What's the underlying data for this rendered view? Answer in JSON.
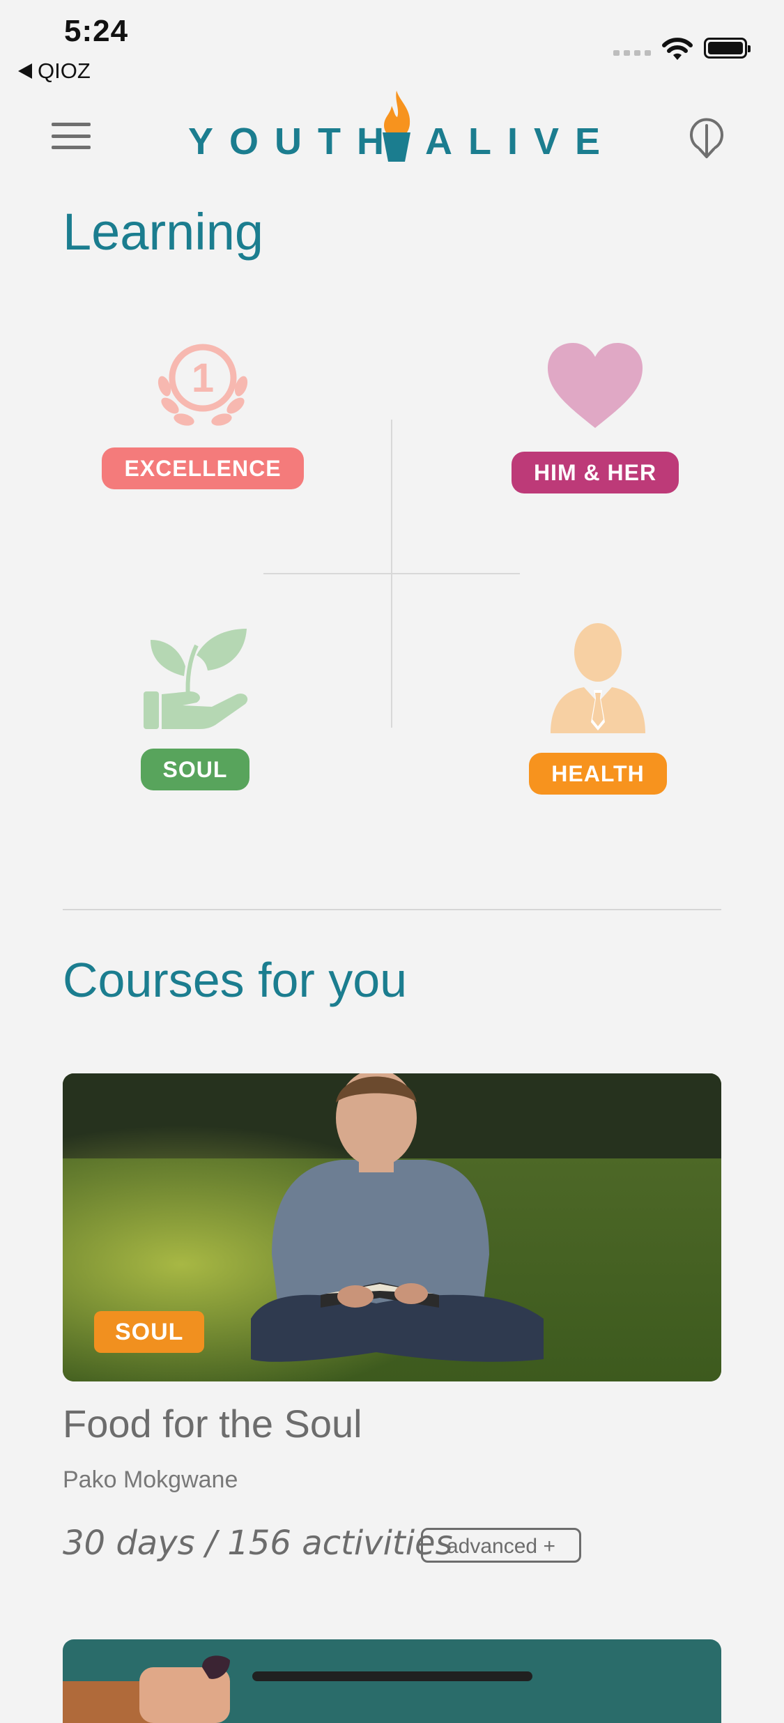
{
  "status_bar": {
    "time": "5:24",
    "back_label": "QIOZ"
  },
  "header": {
    "logo_left": "YOUTH",
    "logo_right": "ALIVE",
    "menu_icon": "hamburger-menu-icon",
    "download_icon": "download-pin-icon"
  },
  "learning": {
    "title": "Learning",
    "categories": [
      {
        "label": "EXCELLENCE",
        "icon": "laurel-medal-icon",
        "color": "#f47b7b"
      },
      {
        "label": "HIM & HER",
        "icon": "heart-icon",
        "color": "#bd3a78"
      },
      {
        "label": "SOUL",
        "icon": "hand-plant-icon",
        "color": "#58a45c"
      },
      {
        "label": "HEALTH",
        "icon": "person-icon",
        "color": "#f7931e"
      }
    ]
  },
  "courses": {
    "title": "Courses for you",
    "items": [
      {
        "badge": "SOUL",
        "title": "Food for the Soul",
        "author": "Pako Mokgwane",
        "meta": "30 days / 156 activities",
        "level": "advanced +"
      }
    ]
  },
  "colors": {
    "brand_teal": "#1b7d8f",
    "flame_orange": "#f7931e",
    "background": "#f3f3f3"
  }
}
